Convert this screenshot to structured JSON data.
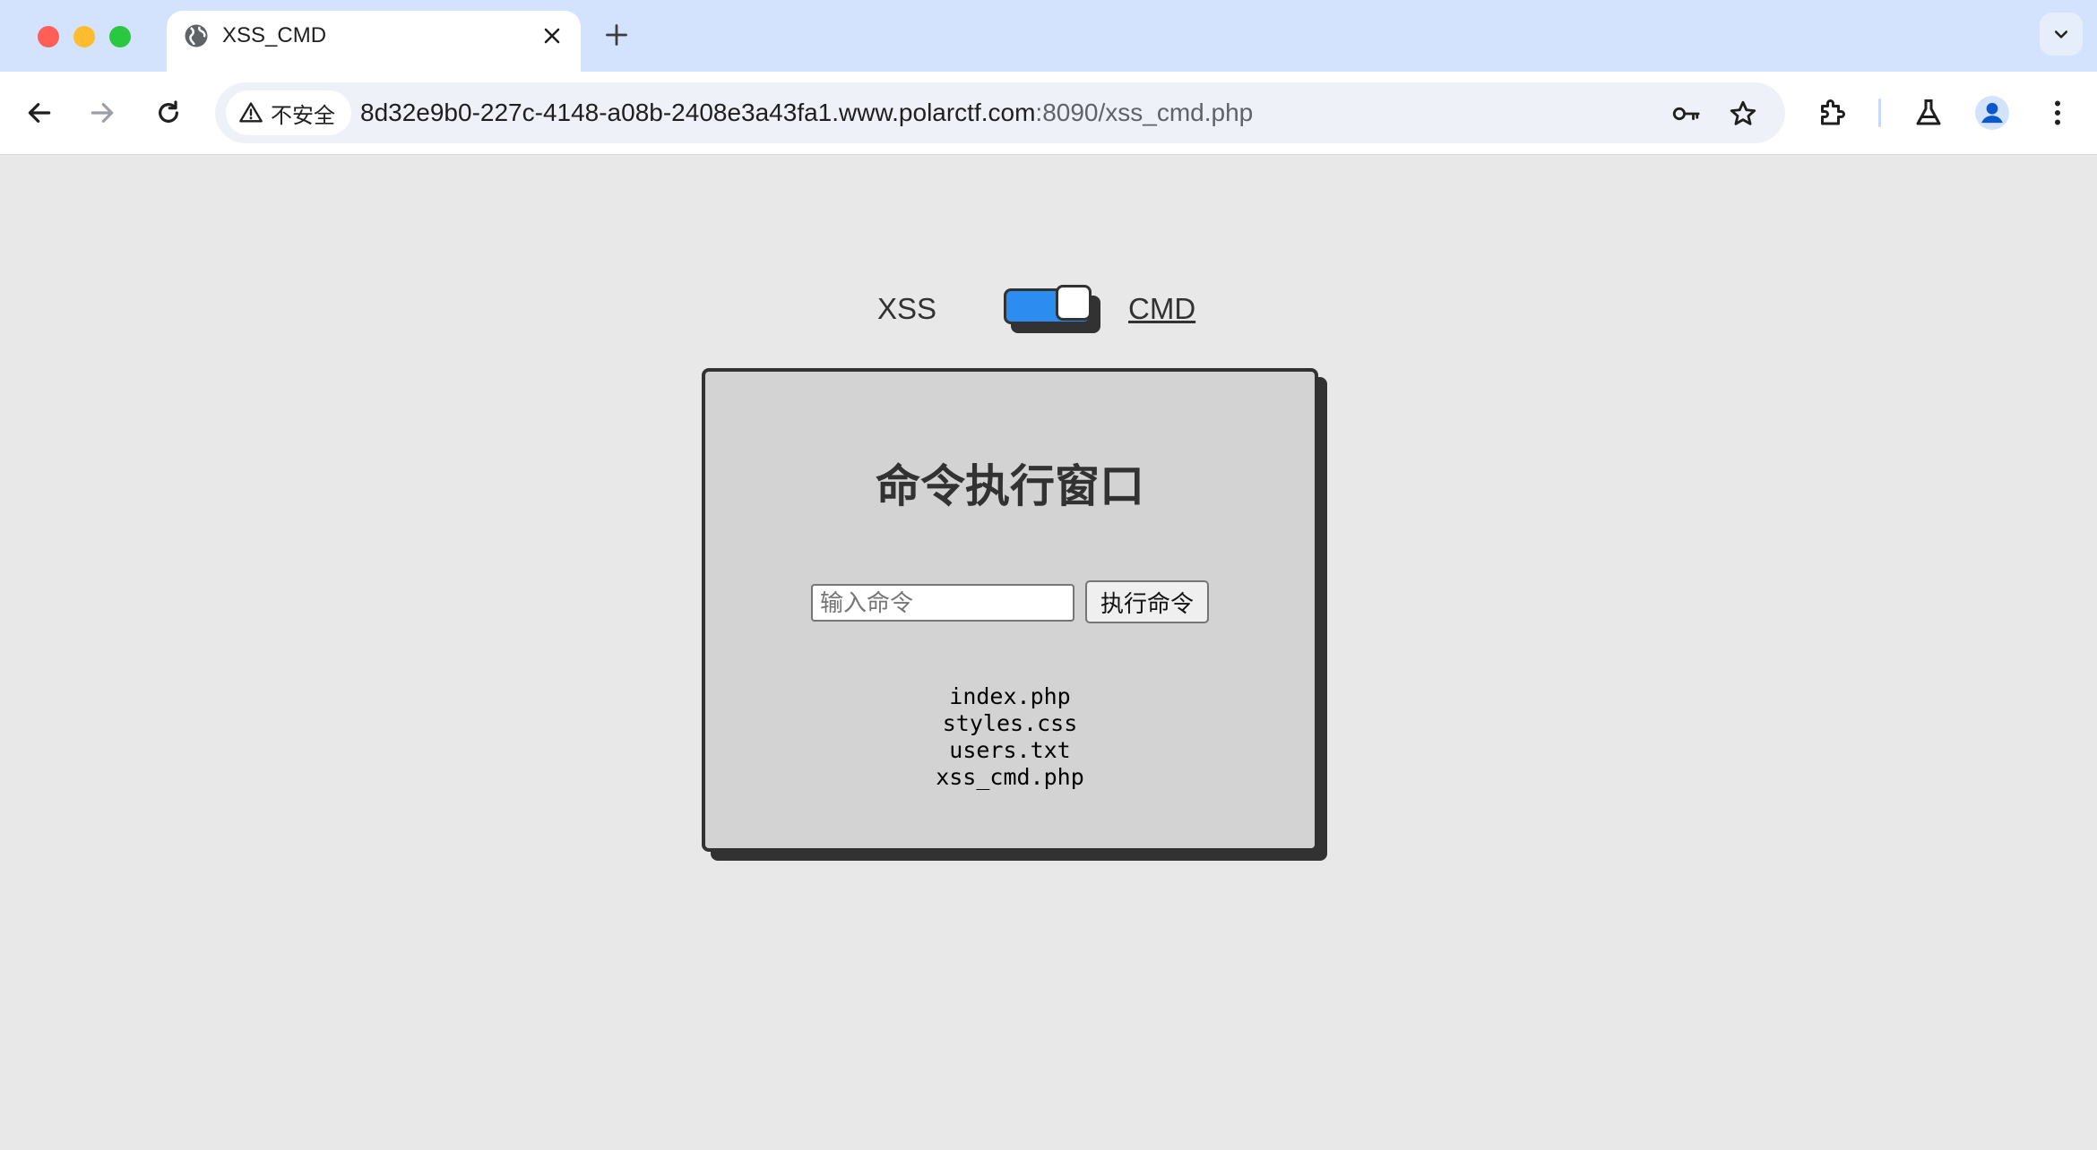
{
  "browser": {
    "tab_title": "XSS_CMD",
    "security_label": "不安全",
    "url_host": "8d32e9b0-227c-4148-a08b-2408e3a43fa1.www.polarctf.com",
    "url_rest": ":8090/xss_cmd.php"
  },
  "page": {
    "toggle_left_label": "XSS",
    "toggle_right_label": "CMD",
    "toggle_state": "CMD",
    "card_title": "命令执行窗口",
    "input_placeholder": "输入命令",
    "input_value": "",
    "exec_button_label": "执行命令",
    "output_lines": [
      "index.php",
      "styles.css",
      "users.txt",
      "xss_cmd.php"
    ]
  },
  "colors": {
    "toggle_on": "#2d8cf0",
    "card_bg": "#d3d3d3",
    "border": "#323232",
    "page_bg": "#e8e8e8"
  }
}
